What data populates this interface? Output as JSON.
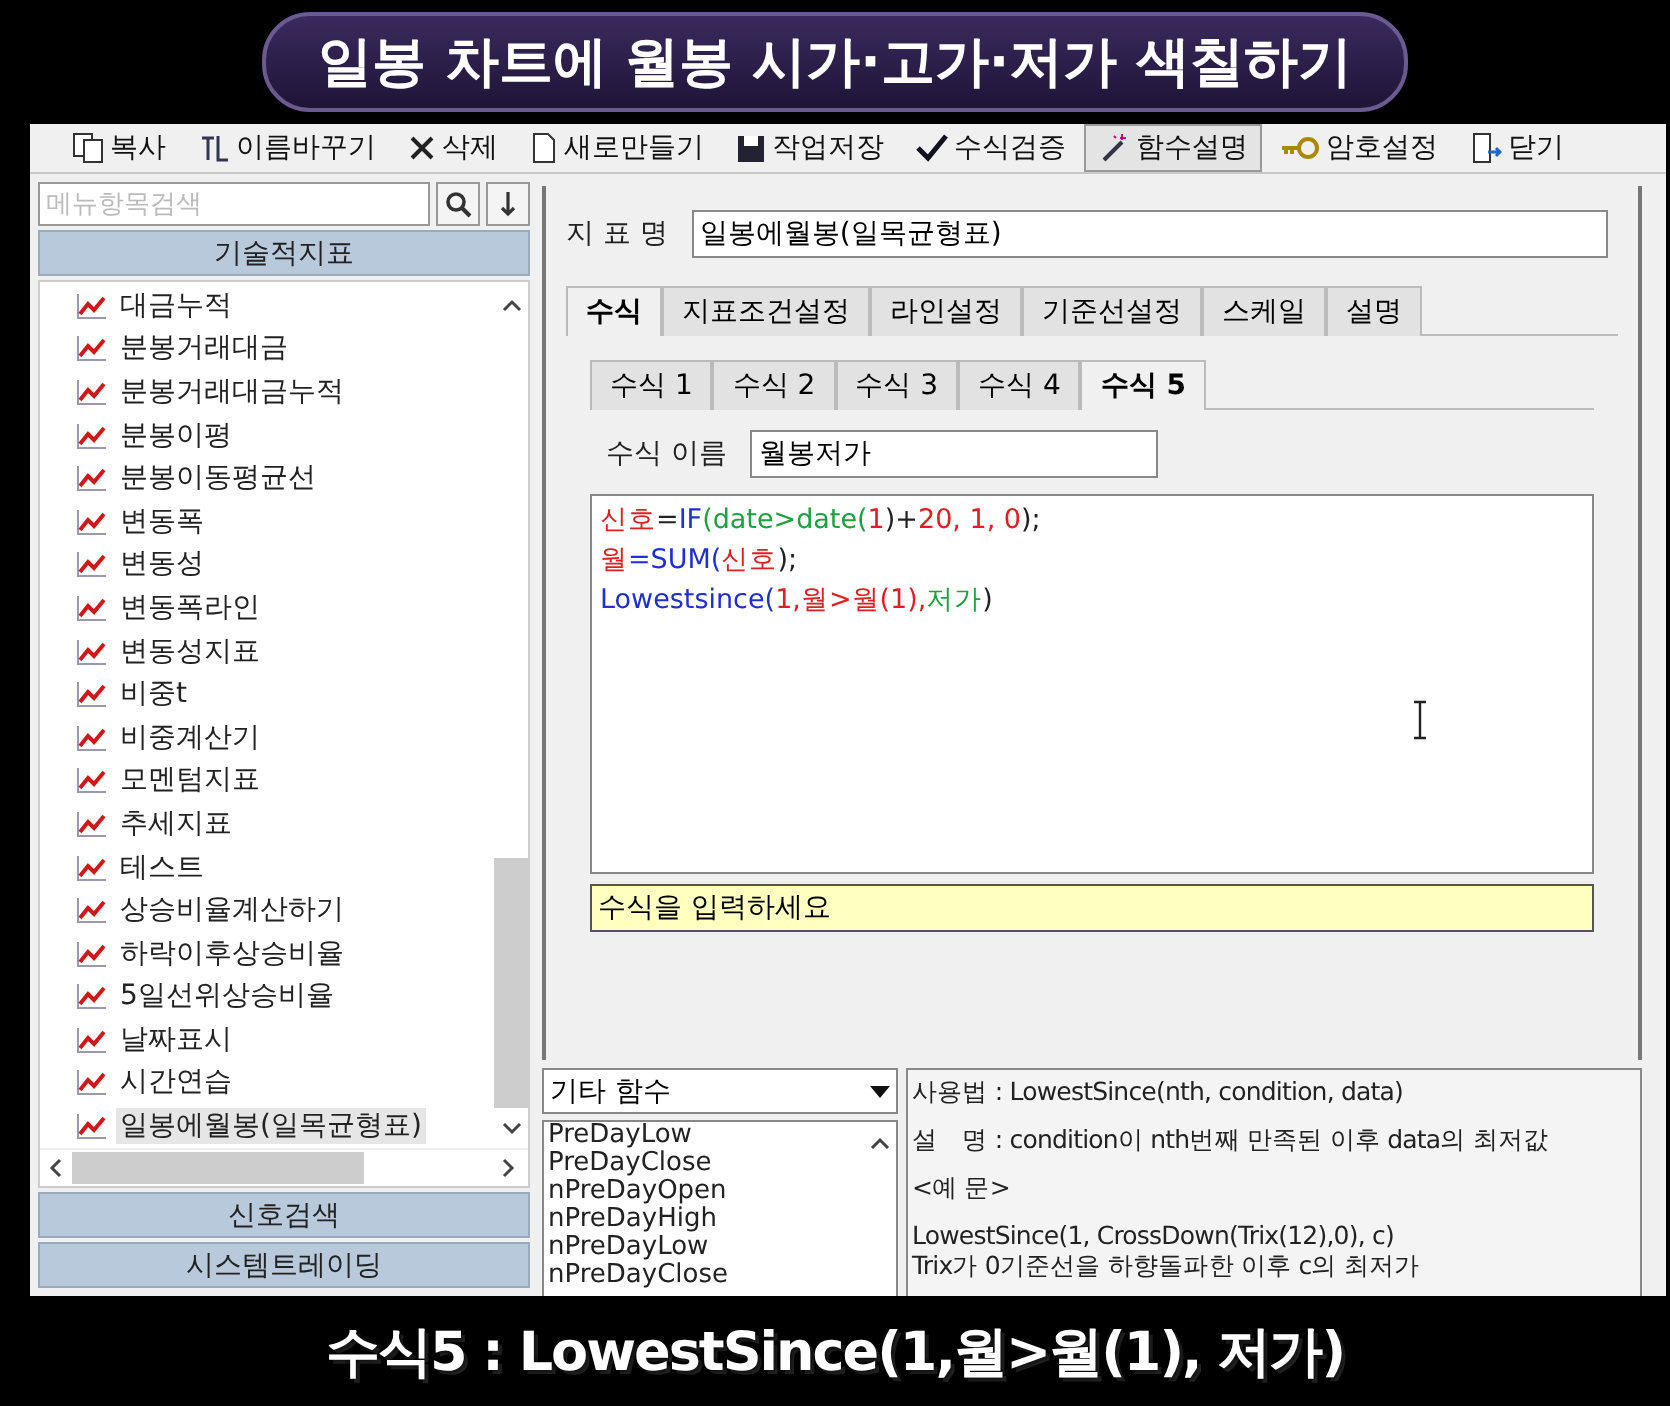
{
  "video_title": "일봉 차트에 월봉 시가·고가·저가 색칠하기",
  "toolbar": [
    {
      "label": "복사",
      "pressed": false
    },
    {
      "label": "이름바꾸기",
      "pressed": false
    },
    {
      "label": "삭제",
      "pressed": false
    },
    {
      "label": "새로만들기",
      "pressed": false
    },
    {
      "label": "작업저장",
      "pressed": false
    },
    {
      "label": "수식검증",
      "pressed": false
    },
    {
      "label": "함수설명",
      "pressed": true
    },
    {
      "label": "암호설정",
      "pressed": false
    },
    {
      "label": "닫기",
      "pressed": false
    }
  ],
  "sidebar": {
    "search": {
      "placeholder": "메뉴항목검색"
    },
    "sections_top": [
      "기술적지표"
    ],
    "items": [
      {
        "label": "대금누적",
        "selected": false
      },
      {
        "label": "분봉거래대금",
        "selected": false
      },
      {
        "label": "분봉거래대금누적",
        "selected": false
      },
      {
        "label": "분봉이평",
        "selected": false
      },
      {
        "label": "분봉이동평균선",
        "selected": false
      },
      {
        "label": "변동폭",
        "selected": false
      },
      {
        "label": "변동성",
        "selected": false
      },
      {
        "label": "변동폭라인",
        "selected": false
      },
      {
        "label": "변동성지표",
        "selected": false
      },
      {
        "label": "비중t",
        "selected": false
      },
      {
        "label": "비중계산기",
        "selected": false
      },
      {
        "label": "모멘텀지표",
        "selected": false
      },
      {
        "label": "추세지표",
        "selected": false
      },
      {
        "label": "테스트",
        "selected": false
      },
      {
        "label": "상승비율계산하기",
        "selected": false
      },
      {
        "label": "하락이후상승비율",
        "selected": false
      },
      {
        "label": "5일선위상승비율",
        "selected": false
      },
      {
        "label": "날짜표시",
        "selected": false
      },
      {
        "label": "시간연습",
        "selected": false
      },
      {
        "label": "일봉에월봉(일목균형표)",
        "selected": true
      }
    ],
    "sections_bottom": [
      "신호검색",
      "시스템트레이딩"
    ]
  },
  "indicator": {
    "label": "지 표 명",
    "value": "일봉에월봉(일목균형표)"
  },
  "tabs": [
    {
      "label": "수식",
      "selected": true
    },
    {
      "label": "지표조건설정",
      "selected": false
    },
    {
      "label": "라인설정",
      "selected": false
    },
    {
      "label": "기준선설정",
      "selected": false
    },
    {
      "label": "스케일",
      "selected": false
    },
    {
      "label": "설명",
      "selected": false
    }
  ],
  "formula_tabs": [
    {
      "label": "수식 1",
      "selected": false
    },
    {
      "label": "수식 2",
      "selected": false
    },
    {
      "label": "수식 3",
      "selected": false
    },
    {
      "label": "수식 4",
      "selected": false
    },
    {
      "label": "수식 5",
      "selected": true
    }
  ],
  "formula_name": {
    "label": "수식 이름",
    "value": "월봉저가"
  },
  "code_lines": [
    [
      {
        "text": "신호",
        "kind": "var"
      },
      {
        "text": "=",
        "kind": "op"
      },
      {
        "text": "IF",
        "kind": "func"
      },
      {
        "text": "(date>date(",
        "kind": "field"
      },
      {
        "text": "1",
        "kind": "num"
      },
      {
        "text": ")+",
        "kind": "op"
      },
      {
        "text": "20, 1, 0",
        "kind": "num"
      },
      {
        "text": ");",
        "kind": "op"
      }
    ],
    [
      {
        "text": "월",
        "kind": "var"
      },
      {
        "text": "=SUM(",
        "kind": "func"
      },
      {
        "text": "신호",
        "kind": "var"
      },
      {
        "text": ");",
        "kind": "op"
      }
    ],
    [
      {
        "text": "Lowestsince(",
        "kind": "func"
      },
      {
        "text": "1,월>월(1),",
        "kind": "var"
      },
      {
        "text": "저가",
        "kind": "field"
      },
      {
        "text": ")",
        "kind": "op"
      }
    ]
  ],
  "hint": "수식을 입력하세요",
  "function_category": "기타 함수",
  "functions": [
    "PreDayLow",
    "PreDayClose",
    "nPreDayOpen",
    "nPreDayHigh",
    "nPreDayLow",
    "nPreDayClose"
  ],
  "help": {
    "usage": "사용법 : LowestSince(nth, condition, data)",
    "description": "설　명 : condition이 nth번째 만족된 이후 data의 최저값",
    "example_heading": "<예 문>",
    "example_code": "LowestSince(1, CrossDown(Trix(12),0), c)",
    "example_text": "Trix가 0기준선을 하향돌파한 이후 c의 최저가"
  },
  "caption": "수식5 : LowestSince(1,월>월(1), 저가)"
}
